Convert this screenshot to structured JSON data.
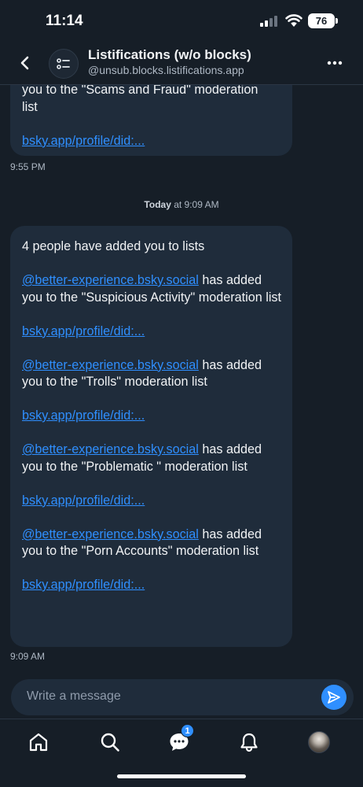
{
  "status_bar": {
    "time": "11:14",
    "battery": "76"
  },
  "header": {
    "title": "Listifications (w/o blocks)",
    "handle": "@unsub.blocks.listifications.app"
  },
  "messages": {
    "previous": {
      "line1": "you to the \"Scams and Fraud\" moderation",
      "line2": "list",
      "link": "bsky.app/profile/did:...",
      "time": "9:55 PM"
    },
    "day_separator": {
      "day": "Today",
      "rest": " at 9:09 AM"
    },
    "latest": {
      "intro": "4 people have added you to lists",
      "entries": [
        {
          "user": "@better-experience.bsky.social",
          "text": " has added you to the \"Suspicious Activity\" moderation list",
          "link": "bsky.app/profile/did:..."
        },
        {
          "user": "@better-experience.bsky.social",
          "text": " has added you to the \"Trolls\" moderation list",
          "link": "bsky.app/profile/did:..."
        },
        {
          "user": "@better-experience.bsky.social",
          "text": " has added you to the \"Problematic \" moderation list",
          "link": "bsky.app/profile/did:..."
        },
        {
          "user": "@better-experience.bsky.social",
          "text": " has added you to the \"Porn Accounts\" moderation list",
          "link": "bsky.app/profile/did:..."
        }
      ],
      "time": "9:09 AM"
    }
  },
  "composer": {
    "placeholder": "Write a message"
  },
  "bottom_nav": {
    "items": [
      "home-icon",
      "search-icon",
      "chat-icon",
      "bell-icon",
      "profile-avatar"
    ],
    "chat_badge": "1"
  },
  "colors": {
    "background": "#161e27",
    "bubble": "#1f2c3b",
    "accent": "#2f8fff"
  }
}
